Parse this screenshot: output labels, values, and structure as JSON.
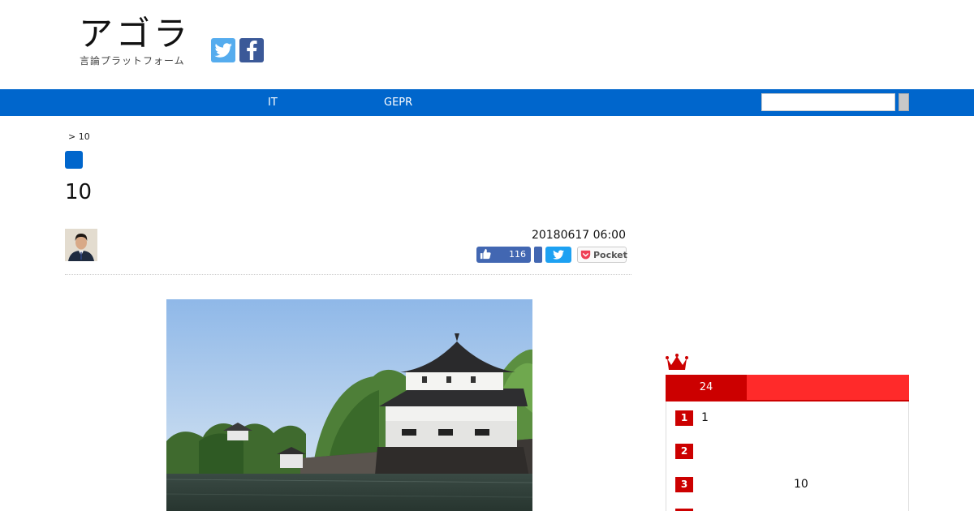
{
  "site": {
    "logo_title": "アゴラ",
    "logo_subtitle": "言論プラットフォーム",
    "social": {
      "twitter_icon": "twitter-icon",
      "facebook_icon": "facebook-icon"
    }
  },
  "nav": {
    "items": [
      {
        "label": "IT"
      },
      {
        "label": "GEPR"
      }
    ],
    "search": {
      "value": "",
      "placeholder": ""
    },
    "accent_color": "#0066cc"
  },
  "article": {
    "breadcrumb": "> 10",
    "title": "10",
    "date": "20180617 06:00",
    "share": {
      "like_count": "116",
      "pocket_label": "Pocket"
    }
  },
  "sidebar": {
    "ranking_tab": "24",
    "items": [
      {
        "rank": "1",
        "text": "1"
      },
      {
        "rank": "2",
        "text": ""
      },
      {
        "rank": "3",
        "text": "10"
      }
    ],
    "accent_color": "#cc0000"
  }
}
